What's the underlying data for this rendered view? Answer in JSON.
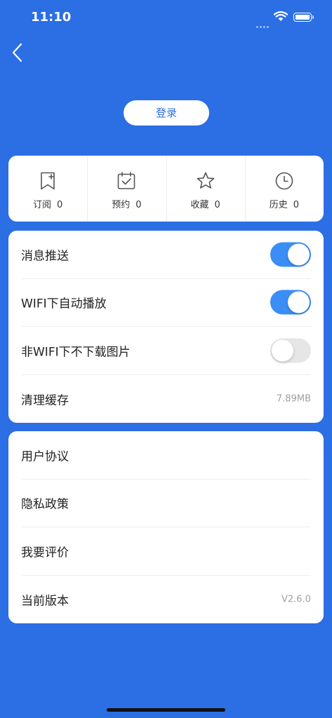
{
  "status_bar": {
    "time": "11:10"
  },
  "header": {
    "login_label": "登录"
  },
  "stats": [
    {
      "label": "订阅",
      "count": "0",
      "icon": "bookmark-plus-icon"
    },
    {
      "label": "预约",
      "count": "0",
      "icon": "calendar-check-icon"
    },
    {
      "label": "收藏",
      "count": "0",
      "icon": "star-icon"
    },
    {
      "label": "历史",
      "count": "0",
      "icon": "clock-icon"
    }
  ],
  "settings": {
    "push": {
      "label": "消息推送",
      "enabled": true
    },
    "wifi_autoplay": {
      "label": "WIFI下自动播放",
      "enabled": true
    },
    "no_image_download": {
      "label": "非WIFI下不下载图片",
      "enabled": false
    },
    "clear_cache": {
      "label": "清理缓存",
      "value": "7.89MB"
    }
  },
  "info": {
    "user_agreement": {
      "label": "用户协议"
    },
    "privacy_policy": {
      "label": "隐私政策"
    },
    "rate_app": {
      "label": "我要评价"
    },
    "version": {
      "label": "当前版本",
      "value": "V2.6.0"
    }
  },
  "colors": {
    "background": "#2c6ee4",
    "toggle_on": "#3a8ef6",
    "toggle_off": "#e6e6e6"
  }
}
